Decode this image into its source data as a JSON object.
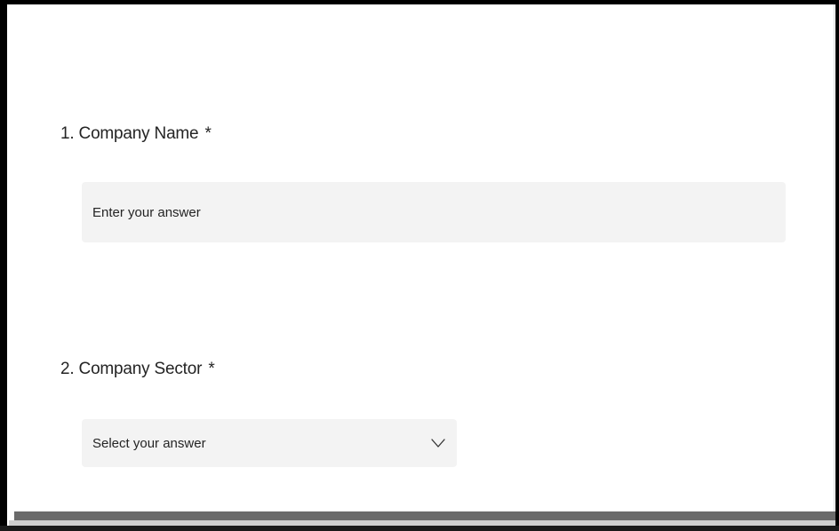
{
  "questions": [
    {
      "number": "1.",
      "title": "Company Name",
      "required_marker": "*",
      "input": {
        "type": "text",
        "placeholder": "Enter your answer"
      }
    },
    {
      "number": "2.",
      "title": "Company Sector",
      "required_marker": "*",
      "input": {
        "type": "dropdown",
        "placeholder": "Select your answer",
        "icon": "chevron-down-icon"
      }
    }
  ],
  "colors": {
    "field_background": "#f3f3f3",
    "text": "#242424",
    "frame_border": "#000000"
  }
}
